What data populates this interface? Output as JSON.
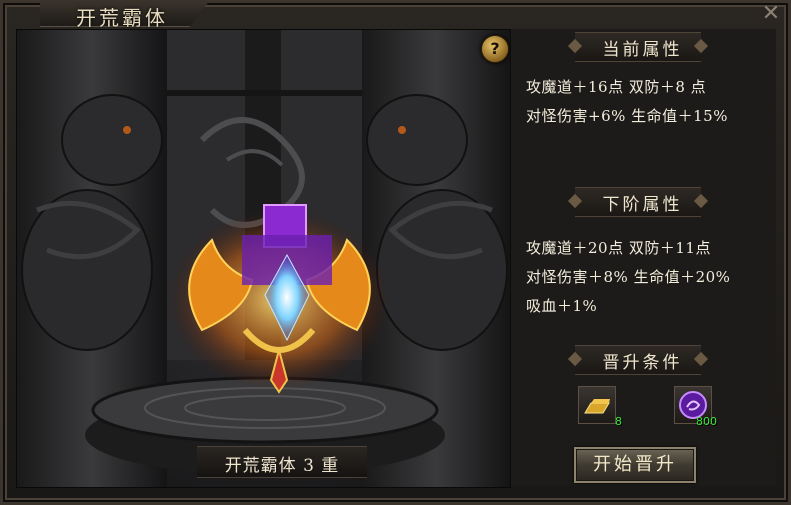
{
  "window": {
    "title": "开荒霸体",
    "close_glyph": "✕",
    "help_glyph": "?"
  },
  "scene": {
    "level_label": "开荒霸体 3 重"
  },
  "current_attributes": {
    "title": "当前属性",
    "lines": [
      "攻魔道＋16点  双防＋8  点",
      "对怪伤害+6%  生命值＋15%"
    ]
  },
  "next_attributes": {
    "title": "下阶属性",
    "lines": [
      "攻魔道＋20点  双防＋11点",
      "对怪伤害＋8% 生命值＋20%",
      "吸血＋1%"
    ]
  },
  "requirements": {
    "title": "晋升条件",
    "items": [
      {
        "icon": "gold-bar-icon",
        "count": "8"
      },
      {
        "icon": "purple-orb-icon",
        "count": "800"
      }
    ]
  },
  "upgrade_button": {
    "label": "开始晋升"
  },
  "colors": {
    "accent": "#e8c46a",
    "count_green": "#39e639",
    "text": "#f3eddc"
  }
}
